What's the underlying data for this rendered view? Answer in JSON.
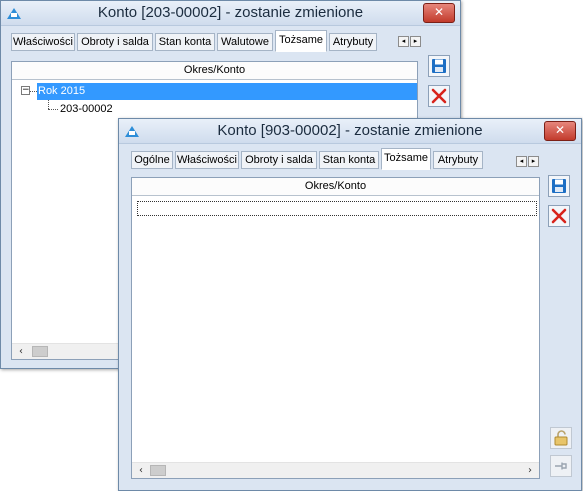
{
  "back_window": {
    "title": "Konto [203-00002] - zostanie zmienione",
    "tabs": [
      {
        "label": "Właściwości"
      },
      {
        "label": "Obroty i salda"
      },
      {
        "label": "Stan konta"
      },
      {
        "label": "Walutowe"
      },
      {
        "label": "Tożsame"
      },
      {
        "label": "Atrybuty"
      }
    ],
    "active_tab": "Tożsame",
    "column_header": "Okres/Konto",
    "tree": {
      "root_label": "Rok 2015",
      "root_expander": "−",
      "child_label": "203-00002"
    }
  },
  "front_window": {
    "title": "Konto [903-00002] - zostanie zmienione",
    "tabs": [
      {
        "label": "Ogólne"
      },
      {
        "label": "Właściwości"
      },
      {
        "label": "Obroty i salda"
      },
      {
        "label": "Stan konta"
      },
      {
        "label": "Tożsame"
      },
      {
        "label": "Atrybuty"
      }
    ],
    "active_tab": "Tożsame",
    "column_header": "Okres/Konto"
  },
  "glyphs": {
    "close": "✕",
    "scroll_left": "‹",
    "scroll_right": "›",
    "tab_left": "◂",
    "tab_right": "▸"
  },
  "colors": {
    "selection": "#3399ff",
    "accent_blue": "#1e6fc4",
    "delete_red": "#d8231b"
  }
}
